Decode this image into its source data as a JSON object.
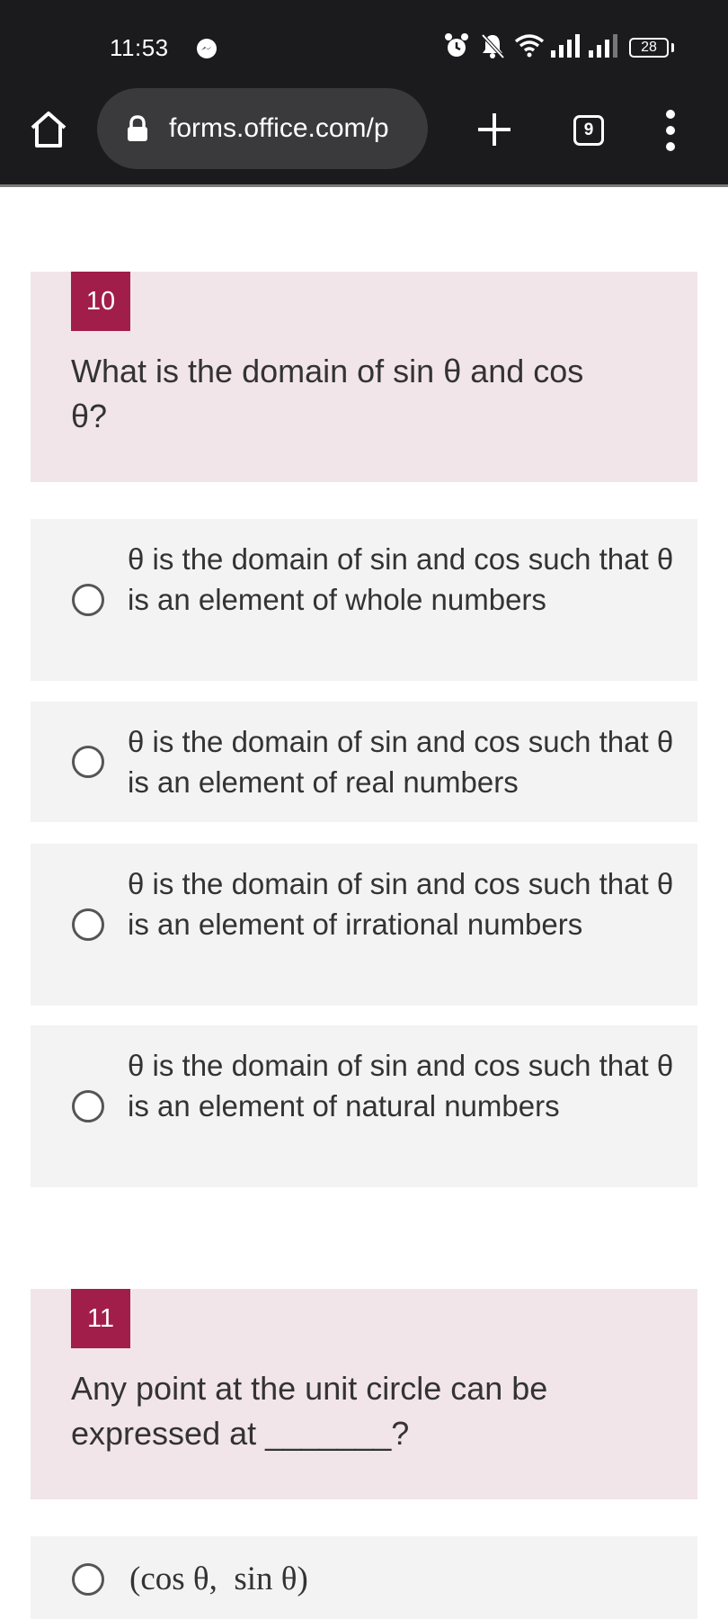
{
  "status_bar": {
    "time": "11:53",
    "battery": "28"
  },
  "browser": {
    "url": "forms.office.com/p",
    "tab_count": "9"
  },
  "questions": [
    {
      "number": "10",
      "text": "What is the domain of sin θ and cos θ?",
      "options": [
        "θ is the domain of sin and cos such that θ is an element of whole numbers",
        "θ is the domain of sin and cos such that θ is an element of real numbers",
        "θ is the domain of sin and cos such that θ is an element of irrational numbers",
        "θ is the domain of sin and cos such that θ is an element of natural numbers"
      ]
    },
    {
      "number": "11",
      "text": "Any point at the unit circle can be expressed at _______?",
      "options": [
        "(cos θ,  sin θ)"
      ]
    }
  ],
  "colors": {
    "chrome": "#1b1b1d",
    "question_badge": "#a11e4a",
    "question_bg": "#f2e5ea",
    "option_bg": "#f3f3f3"
  },
  "icons": [
    "home-icon",
    "lock-icon",
    "plus-icon",
    "tabs-icon",
    "overflow-menu-icon",
    "alarm-icon",
    "mute-icon",
    "wifi-icon",
    "signal-icon",
    "battery-icon",
    "messenger-icon"
  ]
}
